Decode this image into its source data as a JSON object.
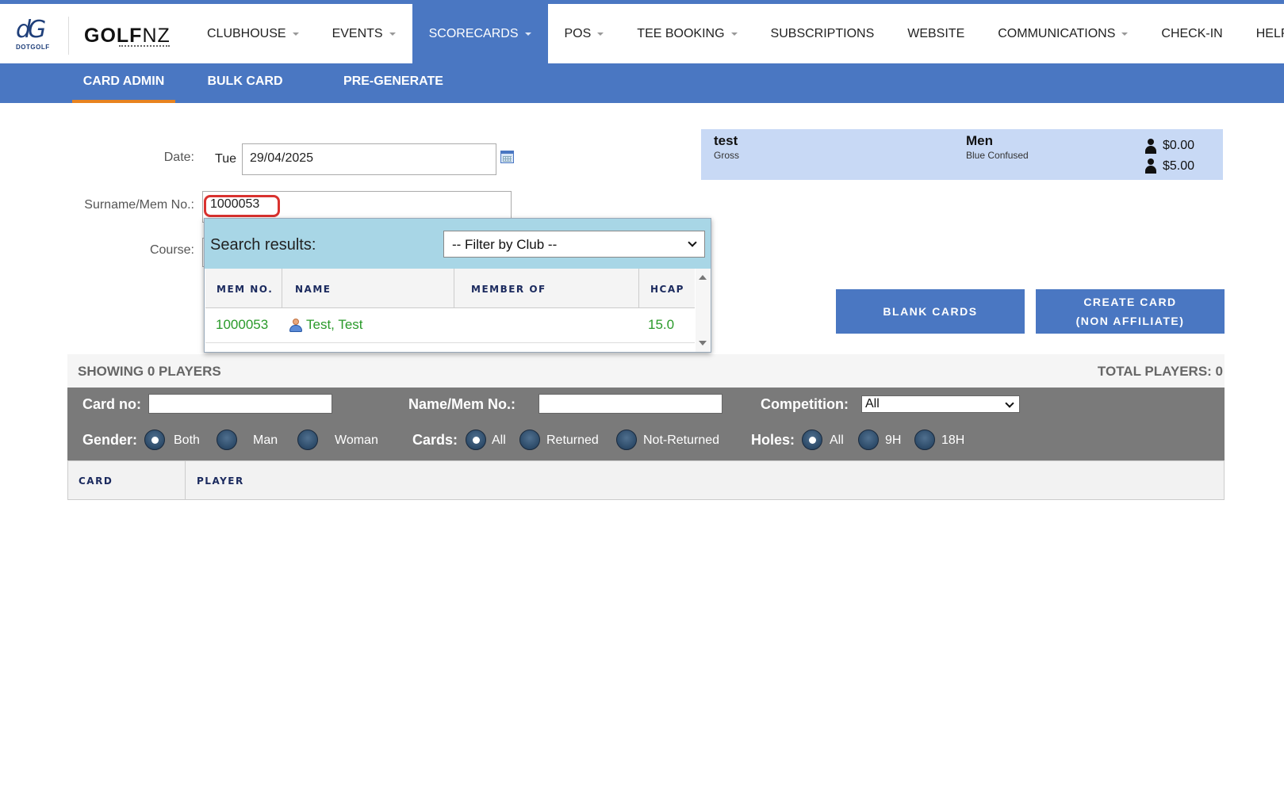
{
  "brand": {
    "dotgolf_mark": "dG",
    "dotgolf_text": "DOTGOLF",
    "golf_text": "G",
    "golf_o": "O",
    "golf_lf": "LF",
    "nz_text": "NZ"
  },
  "menu": [
    {
      "label": "CLUBHOUSE",
      "dropdown": true
    },
    {
      "label": "EVENTS",
      "dropdown": true
    },
    {
      "label": "SCORECARDS",
      "dropdown": true,
      "active": true
    },
    {
      "label": "POS",
      "dropdown": true
    },
    {
      "label": "TEE BOOKING",
      "dropdown": true
    },
    {
      "label": "SUBSCRIPTIONS",
      "dropdown": false
    },
    {
      "label": "WEBSITE",
      "dropdown": false
    },
    {
      "label": "COMMUNICATIONS",
      "dropdown": true
    },
    {
      "label": "CHECK-IN",
      "dropdown": false
    },
    {
      "label": "HELP",
      "dropdown": true
    }
  ],
  "subnav": {
    "card_admin": "CARD ADMIN",
    "bulk_card_admin": "BULK CARD ADMIN",
    "pre_generate_cards": "PRE-GENERATE CARDS"
  },
  "form": {
    "date_label": "Date:",
    "day": "Tue",
    "date_value": "29/04/2025",
    "surname_label": "Surname/Mem No.:",
    "surname_value": "1000053",
    "course_label": "Course:"
  },
  "info": {
    "name": "test",
    "name_sub": "Gross",
    "category": "Men",
    "category_sub": "Blue Confused",
    "price_1": "$0.00",
    "price_2": "$5.00"
  },
  "buttons": {
    "blank_cards": "BLANK CARDS",
    "create_card_line1": "CREATE CARD",
    "create_card_line2": "(NON AFFILIATE)"
  },
  "summary": {
    "showing": "SHOWING 0  PLAYERS",
    "total": "TOTAL PLAYERS: 0"
  },
  "filters": {
    "card_no_label": "Card no:",
    "name_label": "Name/Mem No.:",
    "competition_label": "Competition:",
    "competition_value": "All",
    "gender_label": "Gender:",
    "gender_options": [
      "Both",
      "Man",
      "Woman"
    ],
    "cards_label": "Cards:",
    "cards_options": [
      "All",
      "Returned",
      "Not-Returned"
    ],
    "holes_label": "Holes:",
    "holes_options": [
      "All",
      "9H",
      "18H"
    ]
  },
  "table": {
    "col_card": "CARD",
    "col_player": "PLAYER"
  },
  "popup": {
    "title": "Search results:",
    "filter_value": "-- Filter by Club --",
    "columns": [
      "MEM NO.",
      "NAME",
      "MEMBER OF",
      "HCAP"
    ],
    "rows": [
      {
        "mem_no": "1000053",
        "name": "Test, Test",
        "member_of": "",
        "hcap": "15.0"
      }
    ]
  },
  "colors": {
    "primary": "#4a77c2",
    "accent": "#e8831f",
    "result_text": "#2a9a2a",
    "highlight_ring": "#d9322f"
  }
}
